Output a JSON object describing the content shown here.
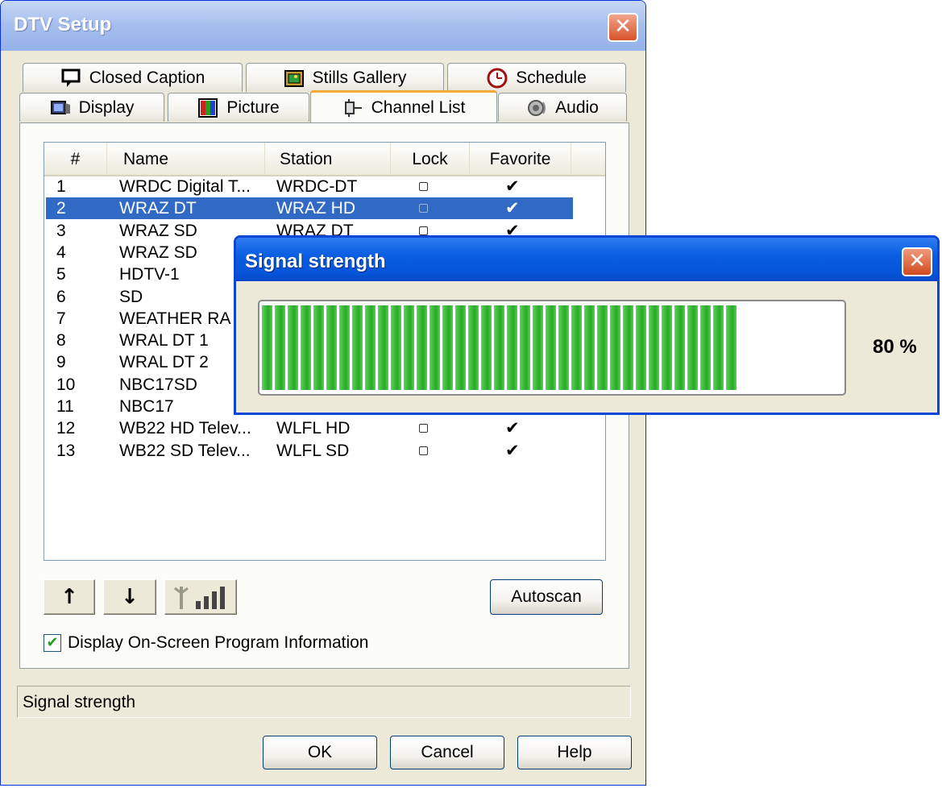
{
  "main_window": {
    "title": "DTV Setup",
    "close_glyph": "✕",
    "tabs_top": [
      {
        "label": "Closed Caption",
        "icon": "caption-icon"
      },
      {
        "label": "Stills Gallery",
        "icon": "gallery-icon"
      },
      {
        "label": "Schedule",
        "icon": "clock-icon"
      }
    ],
    "tabs_bottom": [
      {
        "label": "Display",
        "icon": "monitor-icon"
      },
      {
        "label": "Picture",
        "icon": "picture-icon"
      },
      {
        "label": "Channel List",
        "icon": "channel-icon",
        "active": true
      },
      {
        "label": "Audio",
        "icon": "speaker-icon"
      }
    ],
    "channel_list": {
      "columns": [
        "#",
        "Name",
        "Station",
        "Lock",
        "Favorite"
      ],
      "rows": [
        {
          "num": "1",
          "name": "WRDC Digital T...",
          "station": "WRDC-DT",
          "lock": false,
          "favorite": "✔"
        },
        {
          "num": "2",
          "name": "WRAZ DT",
          "station": "WRAZ HD",
          "lock": false,
          "favorite": "✔",
          "selected": true
        },
        {
          "num": "3",
          "name": "WRAZ SD",
          "station": "WRAZ DT",
          "lock": false,
          "favorite": "✔"
        },
        {
          "num": "4",
          "name": "WRAZ SD",
          "station": "",
          "lock": false,
          "favorite": ""
        },
        {
          "num": "5",
          "name": "HDTV-1",
          "station": "",
          "lock": false,
          "favorite": ""
        },
        {
          "num": "6",
          "name": "SD",
          "station": "",
          "lock": false,
          "favorite": ""
        },
        {
          "num": "7",
          "name": "WEATHER RA",
          "station": "",
          "lock": false,
          "favorite": ""
        },
        {
          "num": "8",
          "name": "WRAL DT 1",
          "station": "",
          "lock": false,
          "favorite": ""
        },
        {
          "num": "9",
          "name": "WRAL DT 2",
          "station": "",
          "lock": false,
          "favorite": ""
        },
        {
          "num": "10",
          "name": "NBC17SD",
          "station": "",
          "lock": false,
          "favorite": ""
        },
        {
          "num": "11",
          "name": "NBC17",
          "station": "",
          "lock": false,
          "favorite": ""
        },
        {
          "num": "12",
          "name": "WB22 HD Telev...",
          "station": "WLFL HD",
          "lock": false,
          "favorite": "✔"
        },
        {
          "num": "13",
          "name": "WB22 SD Telev...",
          "station": "WLFL SD",
          "lock": false,
          "favorite": "✔"
        }
      ]
    },
    "buttons": {
      "move_up_glyph": "↑",
      "move_down_glyph": "↓",
      "autoscan": "Autoscan",
      "ok": "OK",
      "cancel": "Cancel",
      "help": "Help"
    },
    "display_info_checkbox": {
      "label": "Display On-Screen Program Information",
      "checked": true,
      "glyph": "✔"
    },
    "status_text": "Signal strength"
  },
  "signal_dialog": {
    "title": "Signal strength",
    "close_glyph": "✕",
    "percent_label": "80 %",
    "level": 0.8,
    "bar_color": "#3fbd3f"
  },
  "colors": {
    "selection": "#316ac5",
    "active_tab_accent": "#f5ab36",
    "xp_blue": "#0553d8"
  }
}
